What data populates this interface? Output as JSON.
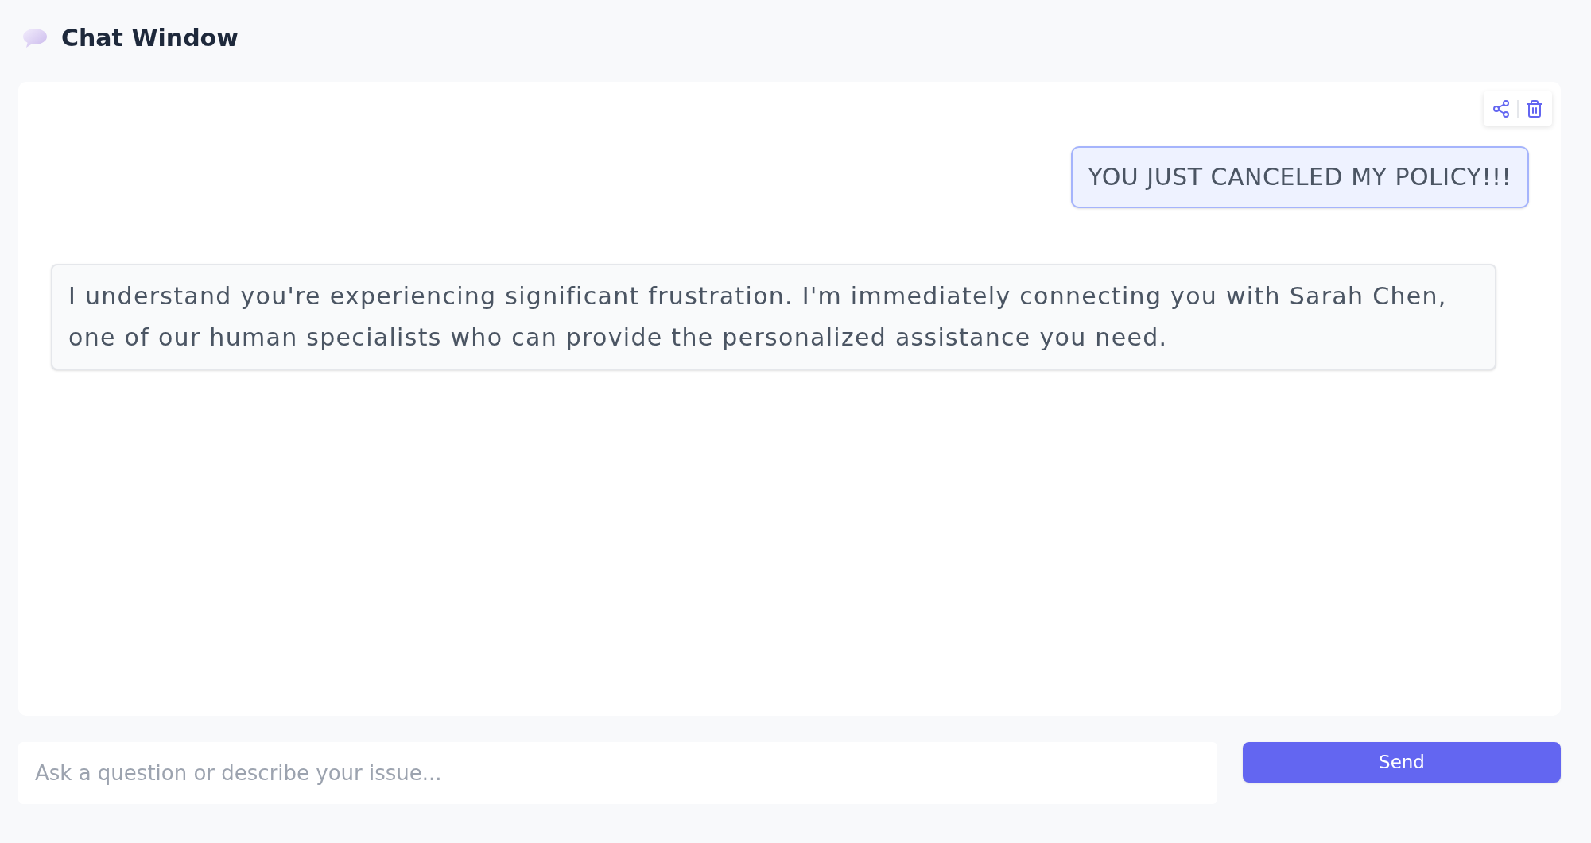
{
  "header": {
    "title": "Chat Window"
  },
  "messages": [
    {
      "kind": "user",
      "text": "YOU JUST CANCELED MY POLICY!!!"
    },
    {
      "kind": "assistant",
      "text": "I understand you're experiencing significant frustration. I'm immediately connecting you with Sarah Chen, one of our human specialists who can provide the personalized assistance you need."
    }
  ],
  "composer": {
    "placeholder": "Ask a question or describe your issue...",
    "send_button": "Send"
  }
}
